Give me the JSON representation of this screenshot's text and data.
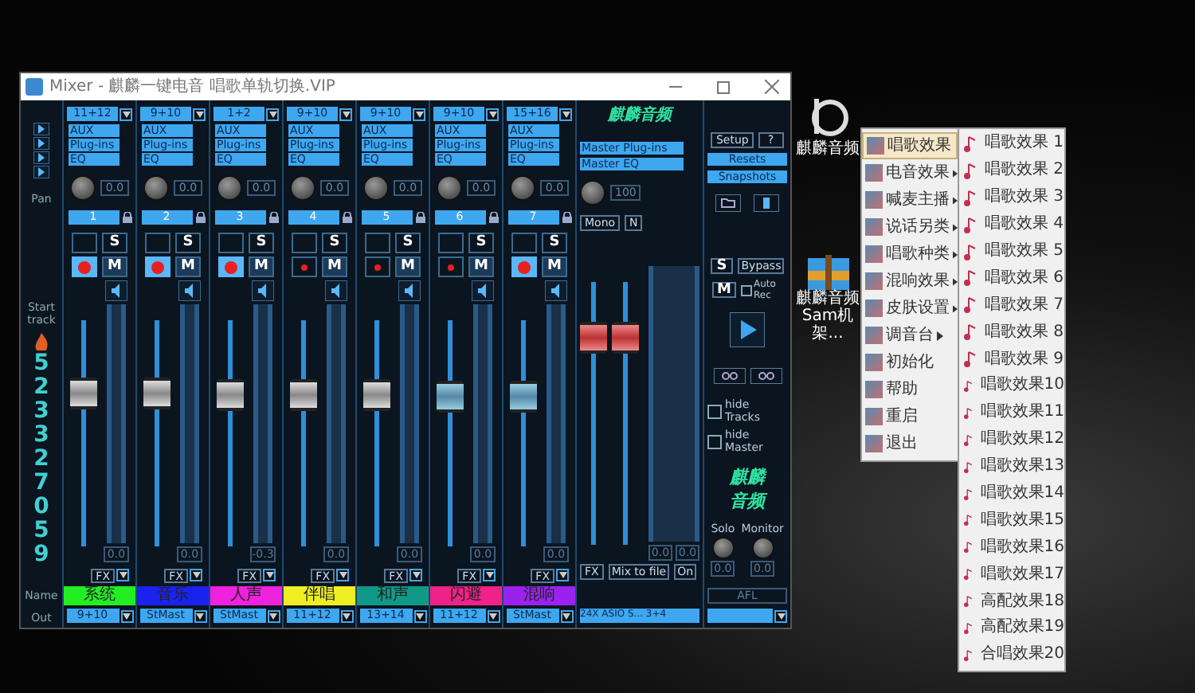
{
  "desktop_icons": [
    {
      "label": "麒麟音频"
    },
    {
      "label": "麒麟音频 Sam机架..."
    }
  ],
  "window": {
    "title": "Mixer - 麒麟一键电音 唱歌单轨切换.VIP"
  },
  "mixer": {
    "left": {
      "pan": "Pan",
      "start_track": "Start track",
      "digits": [
        "5",
        "2",
        "3",
        "3",
        "2",
        "7",
        "0",
        "5",
        "9"
      ],
      "name": "Name",
      "out": "Out"
    },
    "channels": [
      {
        "input": "11+12",
        "aux": "AUX",
        "plugins": "Plug-ins",
        "eq": "EQ",
        "pan": "0.0",
        "number": "1",
        "solo": "S",
        "mute": "M",
        "armed": true,
        "level": 0.75,
        "reading": "0.0",
        "fx": "FX",
        "name": "系统",
        "color": "#22ee22",
        "out": "9+10"
      },
      {
        "input": "9+10",
        "aux": "AUX",
        "plugins": "Plug-ins",
        "eq": "EQ",
        "pan": "0.0",
        "number": "2",
        "solo": "S",
        "mute": "M",
        "armed": true,
        "level": 0.75,
        "reading": "0.0",
        "fx": "FX",
        "name": "音乐",
        "color": "#1a22ee",
        "out": "StMast"
      },
      {
        "input": "1+2",
        "aux": "AUX",
        "plugins": "Plug-ins",
        "eq": "EQ",
        "pan": "0.0",
        "number": "3",
        "solo": "S",
        "mute": "M",
        "armed": true,
        "level": 0.74,
        "reading": "-0.3",
        "fx": "FX",
        "name": "人声",
        "color": "#ee22dd",
        "out": "StMast"
      },
      {
        "input": "9+10",
        "aux": "AUX",
        "plugins": "Plug-ins",
        "eq": "EQ",
        "pan": "0.0",
        "number": "4",
        "solo": "S",
        "mute": "M",
        "armed": false,
        "level": 0.74,
        "reading": "0.0",
        "fx": "FX",
        "name": "伴唱",
        "color": "#eeee22",
        "out": "11+12"
      },
      {
        "input": "9+10",
        "aux": "AUX",
        "plugins": "Plug-ins",
        "eq": "EQ",
        "pan": "0.0",
        "number": "5",
        "solo": "S",
        "mute": "M",
        "armed": false,
        "level": 0.74,
        "reading": "0.0",
        "fx": "FX",
        "name": "和声",
        "color": "#119988",
        "out": "13+14"
      },
      {
        "input": "9+10",
        "aux": "AUX",
        "plugins": "Plug-ins",
        "eq": "EQ",
        "pan": "0.0",
        "number": "6",
        "solo": "S",
        "mute": "M",
        "armed": false,
        "level": 0.73,
        "reading": "0.0",
        "fx": "FX",
        "name": "闪避",
        "color": "#ee2288",
        "out": "11+12"
      },
      {
        "input": "15+16",
        "aux": "AUX",
        "plugins": "Plug-ins",
        "eq": "EQ",
        "pan": "0.0",
        "number": "7",
        "solo": "S",
        "mute": "M",
        "armed": true,
        "level": 0.73,
        "reading": "0.0",
        "fx": "FX",
        "name": "混响",
        "color": "#9922ee",
        "out": "StMast"
      }
    ],
    "master": {
      "logo": "麒麟音频",
      "plugins": "Master Plug-ins",
      "eq": "Master EQ",
      "pan": "100",
      "mono": "Mono",
      "n": "N",
      "faders": [
        {
          "level": 0.85
        },
        {
          "level": 0.85
        }
      ],
      "readings": [
        "0.0",
        "0.0"
      ],
      "fx": "FX",
      "mix": "Mix to file",
      "on": "On",
      "out": "24X ASIO S... 3+4"
    },
    "panel": {
      "setup": "Setup",
      "help": "?",
      "resets": "Resets",
      "snapshots": "Snapshots",
      "solo": "S",
      "bypass": "Bypass",
      "mute": "M",
      "auto_rec": {
        "label": "Auto Rec",
        "checked": false
      },
      "hide_tracks": {
        "label": "hide Tracks",
        "checked": false
      },
      "hide_master": {
        "label": "hide Master",
        "checked": false
      },
      "logo": [
        "麒麟",
        "音频"
      ],
      "solo_label": "Solo",
      "monitor_label": "Monitor",
      "readings": [
        "0.0",
        "0.0"
      ],
      "afl": "AFL"
    }
  },
  "menu": {
    "items": [
      {
        "label": "唱歌效果",
        "submenu": false,
        "selected": true
      },
      {
        "label": "电音效果",
        "submenu": true,
        "selected": false
      },
      {
        "label": "喊麦主播",
        "submenu": true,
        "selected": false
      },
      {
        "label": "说话另类",
        "submenu": true,
        "selected": false
      },
      {
        "label": "唱歌种类",
        "submenu": true,
        "selected": false
      },
      {
        "label": "混响效果",
        "submenu": true,
        "selected": false
      },
      {
        "label": "皮肤设置",
        "submenu": true,
        "selected": false
      },
      {
        "label": "调音台",
        "submenu": true,
        "selected": false
      },
      {
        "label": "初始化",
        "submenu": false,
        "selected": false
      },
      {
        "label": "帮助",
        "submenu": false,
        "selected": false
      },
      {
        "label": "重启",
        "submenu": false,
        "selected": false
      },
      {
        "label": "退出",
        "submenu": false,
        "selected": false
      }
    ],
    "subitems": [
      "唱歌效果 1",
      "唱歌效果 2",
      "唱歌效果 3",
      "唱歌效果 4",
      "唱歌效果 5",
      "唱歌效果 6",
      "唱歌效果 7",
      "唱歌效果 8",
      "唱歌效果 9",
      "唱歌效果10",
      "唱歌效果11",
      "唱歌效果12",
      "唱歌效果13",
      "唱歌效果14",
      "唱歌效果15",
      "唱歌效果16",
      "唱歌效果17",
      "高配效果18",
      "高配效果19",
      "合唱效果20"
    ]
  }
}
